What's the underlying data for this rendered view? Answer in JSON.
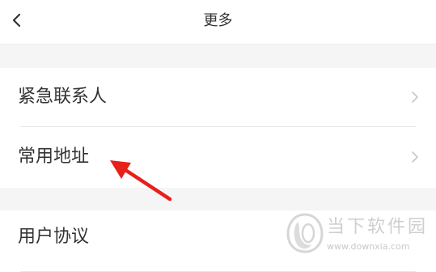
{
  "header": {
    "title": "更多",
    "back_icon": "chevron-left-icon"
  },
  "menu": {
    "items": [
      {
        "label": "紧急联系人",
        "icon": "chevron-right-icon"
      },
      {
        "label": "常用地址",
        "icon": "chevron-right-icon"
      },
      {
        "label": "用户协议",
        "icon": "chevron-right-icon"
      }
    ]
  },
  "annotation": {
    "type": "red-arrow",
    "points_to": "常用地址",
    "color": "#e8201a"
  },
  "watermark": {
    "name": "当下软件园",
    "url": "www.downxia.com"
  },
  "colors": {
    "background": "#ffffff",
    "separator": "#f5f5f5",
    "text": "#333333",
    "chevron": "#c7c7c7"
  }
}
